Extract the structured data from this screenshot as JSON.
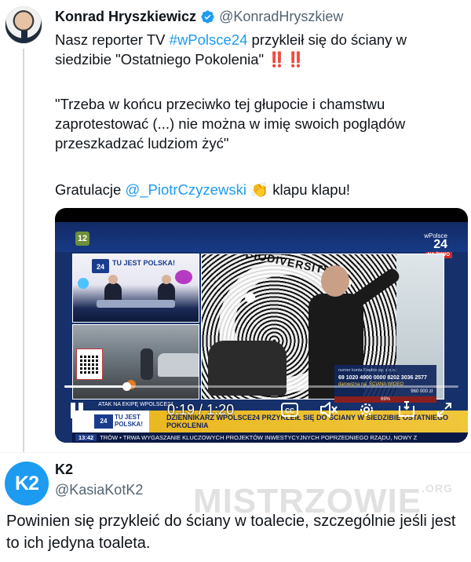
{
  "tweet1": {
    "author_name": "Konrad Hryszkiewicz",
    "author_handle": "@KonradHryszkiew",
    "line1_before": "Nasz reporter TV ",
    "line1_hashtag": "#wPolsce24",
    "line1_after": " przykleił się do ściany w siedzibie \"Ostatniego Pokolenia\" ",
    "line1_excl": "‼️‼️",
    "quote": "\"Trzeba w końcu przeciwko tej głupocie i chamstwu zaprotestować (...) nie można w imię swoich poglądów przeszkadzać ludziom żyć\"",
    "gratulacje_before": "Gratulacje ",
    "gratulacje_mention": "@_PiotrCzyzewski",
    "gratulacje_emoji": "👏",
    "gratulacje_after": " klapu klapu!"
  },
  "video": {
    "channel_number": "12",
    "logo_small": "wPolsce",
    "logo_big": "24",
    "live_badge": "NA ŻYWO",
    "studio_badge": "24",
    "studio_tujest": "TU JEST POLSKA!",
    "wp_badge": "wPolsce",
    "art_text": "BIODIVERSITY",
    "caption_left": "ATAK NA EKIPĘ WPOLSCE24",
    "donate_line1": "numer konta Fradrio sp. z o.o.:",
    "donate_line2": "69 1020 4900 0000 8202 3036 2577",
    "donate_line3": "darowizna na: ŚCIANA WIDEO",
    "donate_amount": "960 000 zł",
    "donate_percent": "69%",
    "ticker_badge": "24",
    "ticker_tujest": "TU JEST POLSKA!",
    "ticker_headline": "DZIENNIKARZ WPOLSCE24 PRZYKLEIŁ SIĘ DO ŚCIANY W SIEDZIBIE OSTATNIEGO POKOLENIA",
    "bottom_time": "13:42",
    "bottom_news": "TRÓW • TRWA WYGASZANIE KLUCZOWYCH PROJEKTÓW INWESTYCYJNYCH POPRZEDNIEGO RZĄDU, NOWY Z",
    "current_time": "0:19",
    "duration": "1:20",
    "progress": 0.158,
    "cc_label": "CC"
  },
  "tweet2": {
    "avatar_text": "K2",
    "author_name": "K2",
    "author_handle": "@KasiaKotK2",
    "text": "Powinien się przykleić do ściany w toalecie, szczególnie jeśli jest to ich jedyna toaleta."
  },
  "watermark": {
    "text": "MISTRZOWIE",
    "suffix": ".ORG"
  },
  "colors": {
    "link": "#1d9bf0",
    "secondary_text": "#536471",
    "primary_text": "#0f1419",
    "ticker_yellow": "#e9b51c"
  }
}
